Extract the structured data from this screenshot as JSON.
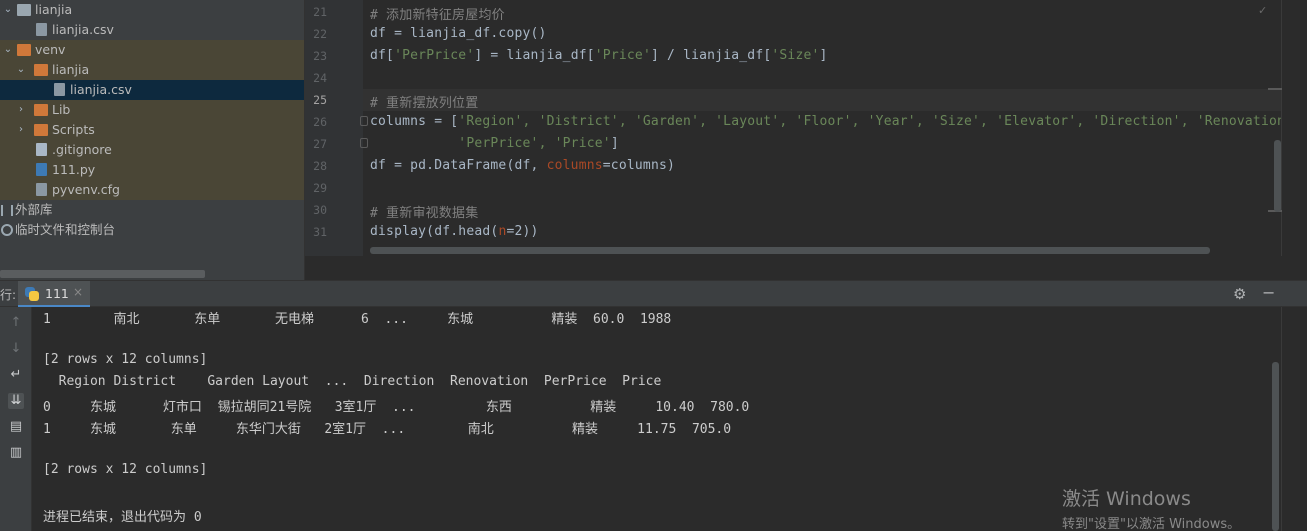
{
  "project_tree": {
    "items": [
      {
        "label": "lianjia",
        "kind": "folder",
        "color": "grey",
        "expanded": true
      },
      {
        "label": "lianjia.csv",
        "kind": "file-csv"
      },
      {
        "label": "venv",
        "kind": "folder",
        "color": "orange",
        "expanded": true
      },
      {
        "label": "lianjia",
        "kind": "folder",
        "color": "orange",
        "expanded": true
      },
      {
        "label": "lianjia.csv",
        "kind": "file-csv",
        "selected": true
      },
      {
        "label": "Lib",
        "kind": "folder",
        "color": "orange",
        "expanded": false
      },
      {
        "label": "Scripts",
        "kind": "folder",
        "color": "orange",
        "expanded": false
      },
      {
        "label": ".gitignore",
        "kind": "file"
      },
      {
        "label": "111.py",
        "kind": "file-py"
      },
      {
        "label": "pyvenv.cfg",
        "kind": "file-cfg"
      },
      {
        "label": "外部库",
        "kind": "library"
      },
      {
        "label": "临时文件和控制台",
        "kind": "scratches"
      }
    ]
  },
  "editor": {
    "line_numbers": [
      "21",
      "22",
      "23",
      "24",
      "25",
      "26",
      "27",
      "28",
      "29",
      "30",
      "31"
    ],
    "lines": {
      "l21_comment": "# 添加新特征房屋均价",
      "l22": "df = lianjia_df.copy()",
      "l23_a": "df[",
      "l23_s1": "'PerPrice'",
      "l23_b": "] = lianjia_df[",
      "l23_s2": "'Price'",
      "l23_c": "] / lianjia_df[",
      "l23_s3": "'Size'",
      "l23_d": "]",
      "l25_comment": "# 重新摆放列位置",
      "l26_a": "columns = [",
      "l26_s": "'Region', 'District', 'Garden', 'Layout', 'Floor', 'Year', 'Size', 'Elevator', 'Direction', 'Renovation",
      "l27_pad": "           ",
      "l27_s": "'PerPrice', 'Price'",
      "l27_b": "]",
      "l28_a": "df = pd.DataFrame(df, ",
      "l28_kw": "columns",
      "l28_b": "=columns)",
      "l30_comment": "# 重新审视数据集",
      "l31_a": "display(df.head(",
      "l31_kw": "n",
      "l31_b": "=2))"
    }
  },
  "run_panel": {
    "prefix": "行:",
    "tab_label": "111",
    "tab_close": "×"
  },
  "console": {
    "lines": [
      "1        南北       东单       无电梯      6  ...     东城          精装  60.0  1988",
      "",
      "[2 rows x 12 columns]",
      "  Region District    Garden Layout  ...  Direction  Renovation  PerPrice  Price",
      "0     东城      灯市口  锡拉胡同21号院   3室1厅  ...         东西          精装     10.40  780.0",
      "1     东城       东单     东华门大街   2室1厅  ...        南北          精装     11.75  705.0",
      "",
      "[2 rows x 12 columns]",
      "",
      "进程已结束，退出代码为 0"
    ]
  },
  "watermark": {
    "line1": "激活 Windows",
    "line2": "转到\"设置\"以激活 Windows。"
  }
}
